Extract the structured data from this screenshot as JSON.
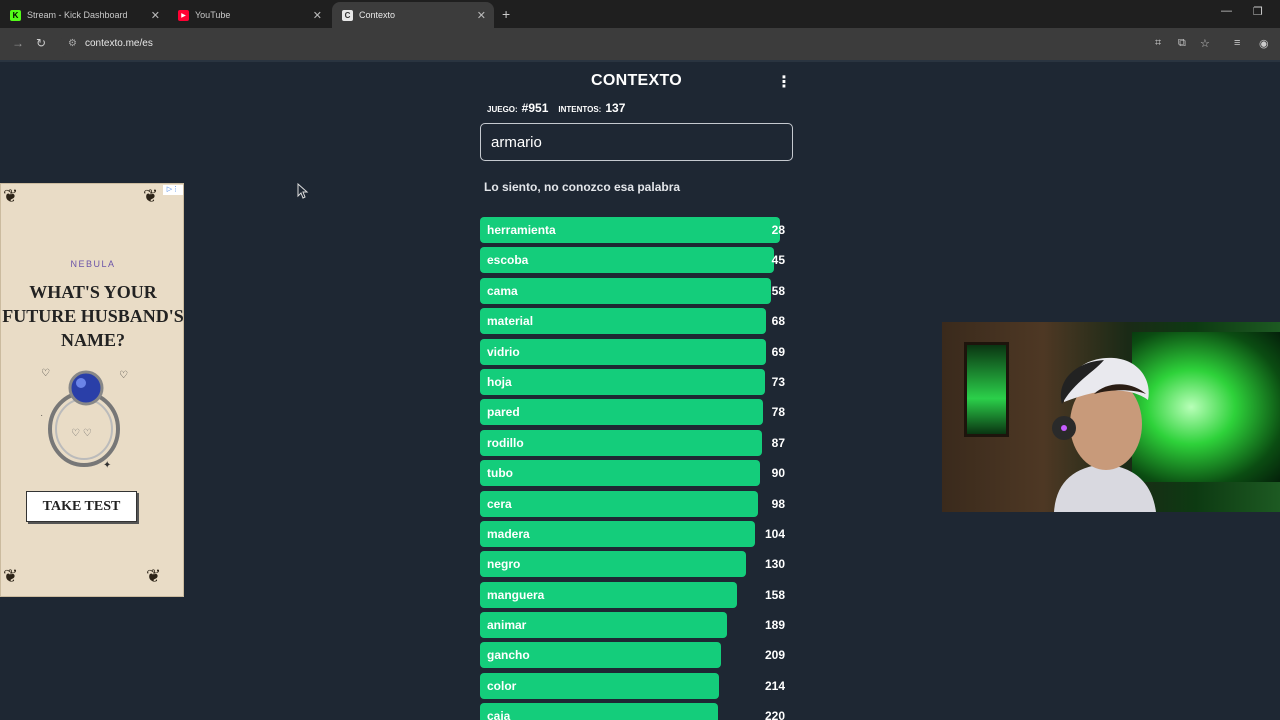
{
  "browser": {
    "tabs": [
      {
        "label": "Stream - Kick Dashboard",
        "icon": "kick-icon",
        "active": false
      },
      {
        "label": "YouTube",
        "icon": "youtube-icon",
        "active": false
      },
      {
        "label": "Contexto",
        "icon": "contexto-icon",
        "active": true
      }
    ],
    "url": "contexto.me/es"
  },
  "game": {
    "title": "CONTEXTO",
    "game_label": "JUEGO:",
    "game_number": "#951",
    "attempts_label": "INTENTOS:",
    "attempts": "137",
    "input_value": "armario",
    "message": "Lo siento, no conozco esa palabra",
    "bar_color": "#14cd7b",
    "guesses": [
      {
        "word": "herramienta",
        "rank": "28",
        "fill": 0.96
      },
      {
        "word": "escoba",
        "rank": "45",
        "fill": 0.94
      },
      {
        "word": "cama",
        "rank": "58",
        "fill": 0.93
      },
      {
        "word": "material",
        "rank": "68",
        "fill": 0.915
      },
      {
        "word": "vidrio",
        "rank": "69",
        "fill": 0.915
      },
      {
        "word": "hoja",
        "rank": "73",
        "fill": 0.91
      },
      {
        "word": "pared",
        "rank": "78",
        "fill": 0.905
      },
      {
        "word": "rodillo",
        "rank": "87",
        "fill": 0.9
      },
      {
        "word": "tubo",
        "rank": "90",
        "fill": 0.895
      },
      {
        "word": "cera",
        "rank": "98",
        "fill": 0.887
      },
      {
        "word": "madera",
        "rank": "104",
        "fill": 0.88
      },
      {
        "word": "negro",
        "rank": "130",
        "fill": 0.85
      },
      {
        "word": "manguera",
        "rank": "158",
        "fill": 0.82
      },
      {
        "word": "animar",
        "rank": "189",
        "fill": 0.79
      },
      {
        "word": "gancho",
        "rank": "209",
        "fill": 0.77
      },
      {
        "word": "color",
        "rank": "214",
        "fill": 0.765
      },
      {
        "word": "caja",
        "rank": "220",
        "fill": 0.76
      }
    ]
  },
  "ad": {
    "brand": "NEBULA",
    "headline_line1": "WHAT'S YOUR",
    "headline_line2": "FUTURE HUSBAND'S",
    "headline_line3": "NAME?",
    "cta": "TAKE TEST"
  }
}
